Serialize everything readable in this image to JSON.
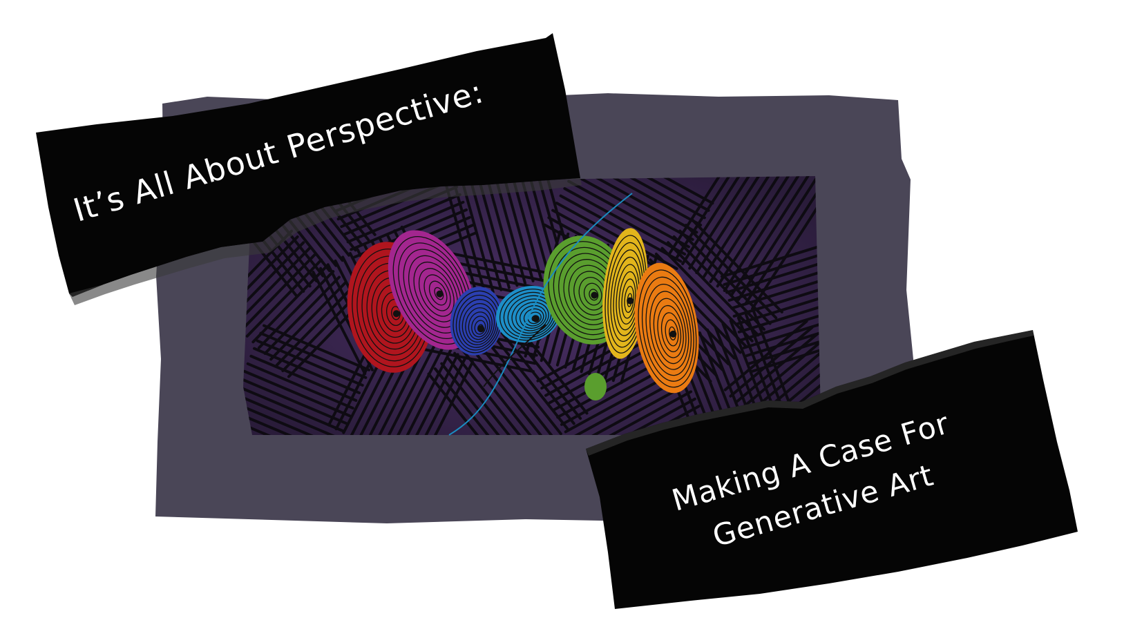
{
  "headline": {
    "line1": "It’s All About Perspective:",
    "line2_a": "Making A Case For",
    "line2_b": "Generative Art"
  },
  "colors": {
    "paper_frame": "#4a4657",
    "background_purple": "#2e1f3f",
    "hatch_lines": "#0e0b12",
    "torn_paper": "#050505",
    "text": "#ffffff",
    "art_palette": [
      "#b0151e",
      "#a3268f",
      "#2b3fb0",
      "#1d8ec8",
      "#5a9e2e",
      "#e2b51c",
      "#ea7b12"
    ]
  },
  "artwork": {
    "description_icon": "generative-art-contour-shapes"
  }
}
